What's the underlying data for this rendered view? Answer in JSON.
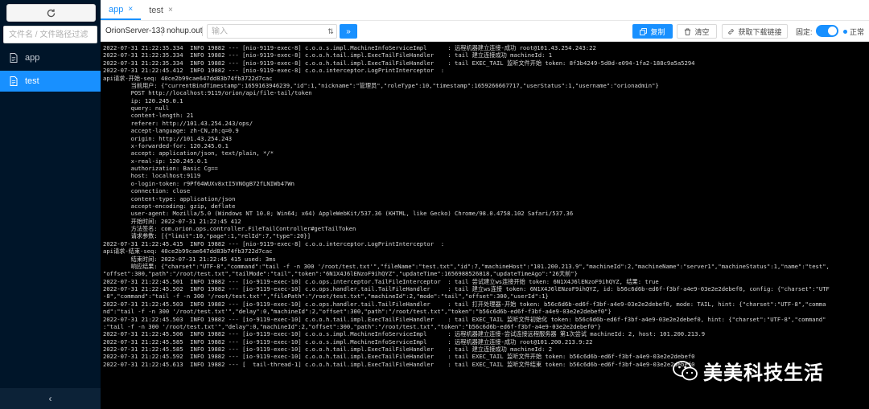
{
  "sidebar": {
    "search_placeholder": "文件名 / 文件路径过滤",
    "items": [
      {
        "label": "app",
        "active": false
      },
      {
        "label": "test",
        "active": true
      }
    ],
    "collapse_glyph": "‹"
  },
  "tabs": [
    {
      "label": "app",
      "close": "×",
      "active": true
    },
    {
      "label": "test",
      "close": "×",
      "active": false
    }
  ],
  "toolbar": {
    "host": "OrionServer-133",
    "file": "nohup.out",
    "input_placeholder": "输入",
    "filter_glyph": "⇅",
    "send_glyph": "»",
    "copy_label": "复制",
    "clear_label": "清空",
    "download_label": "获取下载链接",
    "fixed_label": "固定:",
    "status_label": "正常"
  },
  "log_lines": [
    "2022-07-31 21:22:35.334  INFO 19882 --- [nio-9119-exec-8] c.o.o.s.impl.MachineInfoServiceImpl      : 远程机器建立连接-成功 root@101.43.254.243:22",
    "2022-07-31 21:22:35.334  INFO 19882 --- [nio-9119-exec-8] c.o.o.h.tail.impl.ExecTailFileHandler    : tail 建立连接成功 machineId: 1",
    "2022-07-31 21:22:35.334  INFO 19882 --- [nio-9119-exec-8] c.o.o.h.tail.impl.ExecTailFileHandler    : tail EXEC_TAIL 监听文件开始 token: 8f3b4249-5d0d-e094-1fa2-188c9a5a5294",
    "2022-07-31 21:22:45.412  INFO 19882 --- [nio-9119-exec-8] c.o.o.interceptor.LogPrintInterceptor  :",
    "api请求-开始-seq: 40ce2b99cae647dd83b74fb3722d7cac",
    "        当前用户: {\"currentBindTimestamp\":1659163946239,\"id\":1,\"nickname\":\"管理员\",\"roleType\":10,\"timestamp\":1659266667717,\"userStatus\":1,\"username\":\"orionadmin\"}",
    "        POST http://localhost:9119/orion/api/file-tail/token",
    "        ip: 120.245.0.1",
    "        query: null",
    "        content-length: 21",
    "        referer: http://101.43.254.243/ops/",
    "        accept-language: zh-CN,zh;q=0.9",
    "        origin: http://101.43.254.243",
    "        x-forwarded-for: 120.245.0.1",
    "        accept: application/json, text/plain, */*",
    "        x-real-ip: 120.245.0.1",
    "        authorization: Basic Cg==",
    "        host: localhost:9119",
    "        o-login-token: r9Pf64WUXv8xtI5VNOgB72fLNIWb47Wn",
    "        connection: close",
    "        content-type: application/json",
    "        accept-encoding: gzip, deflate",
    "        user-agent: Mozilla/5.0 (Windows NT 10.0; Win64; x64) AppleWebKit/537.36 (KHTML, like Gecko) Chrome/98.0.4758.102 Safari/537.36",
    "        开始时间: 2022-07-31 21:22:45 412",
    "        方法签名: com.orion.ops.controller.FileTailController#getTailToken",
    "        请求参数: [{\"limit\":10,\"page\":1,\"relId\":7,\"type\":20}]",
    "2022-07-31 21:22:45.415  INFO 19882 --- [nio-9119-exec-8] c.o.o.interceptor.LogPrintInterceptor  :",
    "api请求-结束-seq: 40ce2b99cae647dd83b74fb3722d7cac",
    "        结束时间: 2022-07-31 21:22:45 415 used: 3ms",
    "        响应结果: {\"charset\":\"UTF-8\",\"command\":\"tail -f -n 300 '/root/test.txt'\",\"fileName\":\"test.txt\",\"id\":7,\"machineHost\":\"101.200.213.9\",\"machineId\":2,\"machineName\":\"server1\",\"machineStatus\":1,\"name\":\"test\",",
    "\"offset\":300,\"path\":\"/root/test.txt\",\"tailMode\":\"tail\",\"token\":\"6N1X4J6lENzoF9ihQYZ\",\"updateTime\":1656988526818,\"updateTimeAgo\":\"26天前\"}",
    "2022-07-31 21:22:45.501  INFO 19882 --- [io-9119-exec-10] c.o.ops.interceptor.TailFileInterceptor  : tail 尝试建立ws连接开始 token: 6N1X4J6lENzoF9ihQYZ, 结果: true",
    "2022-07-31 21:22:45.502  INFO 19882 --- [io-9119-exec-10] c.o.ops.handler.tail.TailFileHandler     : tail 建立ws连接 token: 6N1X4J6lENzoF9ihQYZ, id: b56c6d6b-ed6f-f3bf-a4e9-03e2e2debef0, config: {\"charset\":\"UTF",
    "-8\",\"command\":\"tail -f -n 300 '/root/test.txt'\",\"filePath\":\"/root/test.txt\",\"machineId\":2,\"mode\":\"tail\",\"offset\":300,\"userId\":1}",
    "2022-07-31 21:22:45.503  INFO 19882 --- [io-9119-exec-10] c.o.ops.handler.tail.TailFileHandler     : tail 打开处理器-开始 token: b56c6d6b-ed6f-f3bf-a4e9-03e2e2debef0, mode: TAIL, hint: {\"charset\":\"UTF-8\",\"comma",
    "nd\":\"tail -f -n 300 '/root/test.txt'\",\"delay\":0,\"machineId\":2,\"offset\":300,\"path\":\"/root/test.txt\",\"token\":\"b56c6d6b-ed6f-f3bf-a4e9-03e2e2debef0\"}",
    "2022-07-31 21:22:45.503  INFO 19882 --- [io-9119-exec-10] c.o.o.h.tail.impl.ExecTailFileHandler    : tail EXEC_TAIL 监听文件初始化 token: b56c6d6b-ed6f-f3bf-a4e9-03e2e2debef0, hint: {\"charset\":\"UTF-8\",\"command\"",
    ":\"tail -f -n 300 '/root/test.txt'\",\"delay\":0,\"machineId\":2,\"offset\":300,\"path\":\"/root/test.txt\",\"token\":\"b56c6d6b-ed6f-f3bf-a4e9-03e2e2debef0\"}",
    "2022-07-31 21:22:45.506  INFO 19882 --- [io-9119-exec-10] c.o.o.s.impl.MachineInfoServiceImpl      : 远程机器建立连接-尝试连接远程服务器 第1次尝试 machineId: 2, host: 101.200.213.9",
    "2022-07-31 21:22:45.585  INFO 19882 --- [io-9119-exec-10] c.o.o.s.impl.MachineInfoServiceImpl      : 远程机器建立连接-成功 root@101.200.213.9:22",
    "2022-07-31 21:22:45.585  INFO 19882 --- [io-9119-exec-10] c.o.o.h.tail.impl.ExecTailFileHandler    : tail 建立连接成功 machineId: 2",
    "2022-07-31 21:22:45.592  INFO 19882 --- [io-9119-exec-10] c.o.o.h.tail.impl.ExecTailFileHandler    : tail EXEC_TAIL 监听文件开始 token: b56c6d6b-ed6f-f3bf-a4e9-03e2e2debef0",
    "2022-07-31 21:22:45.613  INFO 19882 --- [  tail-thread-1] c.o.o.h.tail.impl.ExecTailFileHandler    : tail EXEC_TAIL 监听文件结束 token: b56c6d6b-ed6f-f3bf-a4e9-03e2e2debef0"
  ],
  "watermark": {
    "text": "美美科技生活"
  },
  "colors": {
    "accent": "#1890ff",
    "sidebar_bg": "#001529",
    "log_bg": "#000000"
  }
}
